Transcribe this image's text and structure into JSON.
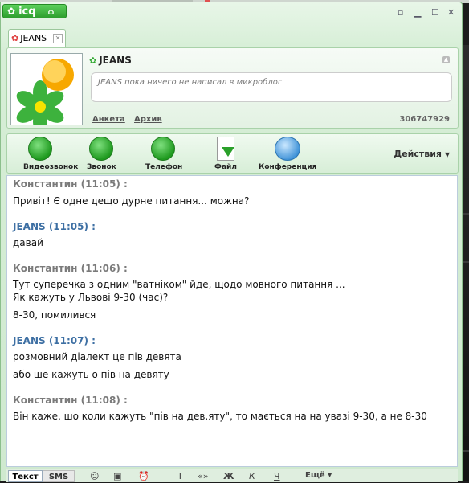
{
  "titlebar": {
    "logo": "icq",
    "icons": [
      "icq-flower-icon",
      "home-icon"
    ],
    "controls": [
      "restore-icon",
      "minimize-icon",
      "maximize-icon",
      "close-icon"
    ]
  },
  "tab": {
    "label": "JEANS"
  },
  "header": {
    "name": "JEANS",
    "microblog": "JEANS пока ничего не написал в микроблог",
    "links": [
      "Анкета",
      "Архив"
    ],
    "uin": "306747929"
  },
  "toolbar": {
    "video": "Видеозвонок",
    "call": "Звонок",
    "phone": "Телефон",
    "file": "Файл",
    "conference": "Конференция",
    "actions": "Действия"
  },
  "chat": [
    {
      "sender": "Константин (11:05) :",
      "lines": [
        "Привіт! Є одне дещо дурне питання... можна?"
      ]
    },
    {
      "sender": "JEANS (11:05) :",
      "lines": [
        "давай"
      ]
    },
    {
      "sender": "Константин (11:06) :",
      "lines": [
        "Тут суперечка з одним \"ватніком\" йде, щодо мовного питання ...",
        "Як кажуть у Львові 9-30 (час)?",
        "8-30, помилився"
      ]
    },
    {
      "sender": "JEANS (11:07) :",
      "lines": [
        "розмовний діалект  це пів девята",
        "або ше кажуть о пів на девяту"
      ]
    },
    {
      "sender": "Константин (11:08) :",
      "lines": [
        "Він каже, шо коли кажуть \"пів на дев.яту\", то мається на на увазі 9-30, а не 8-30"
      ]
    }
  ],
  "bottom": {
    "text_tab": "Текст",
    "sms_tab": "SMS",
    "more": "Ещё"
  }
}
